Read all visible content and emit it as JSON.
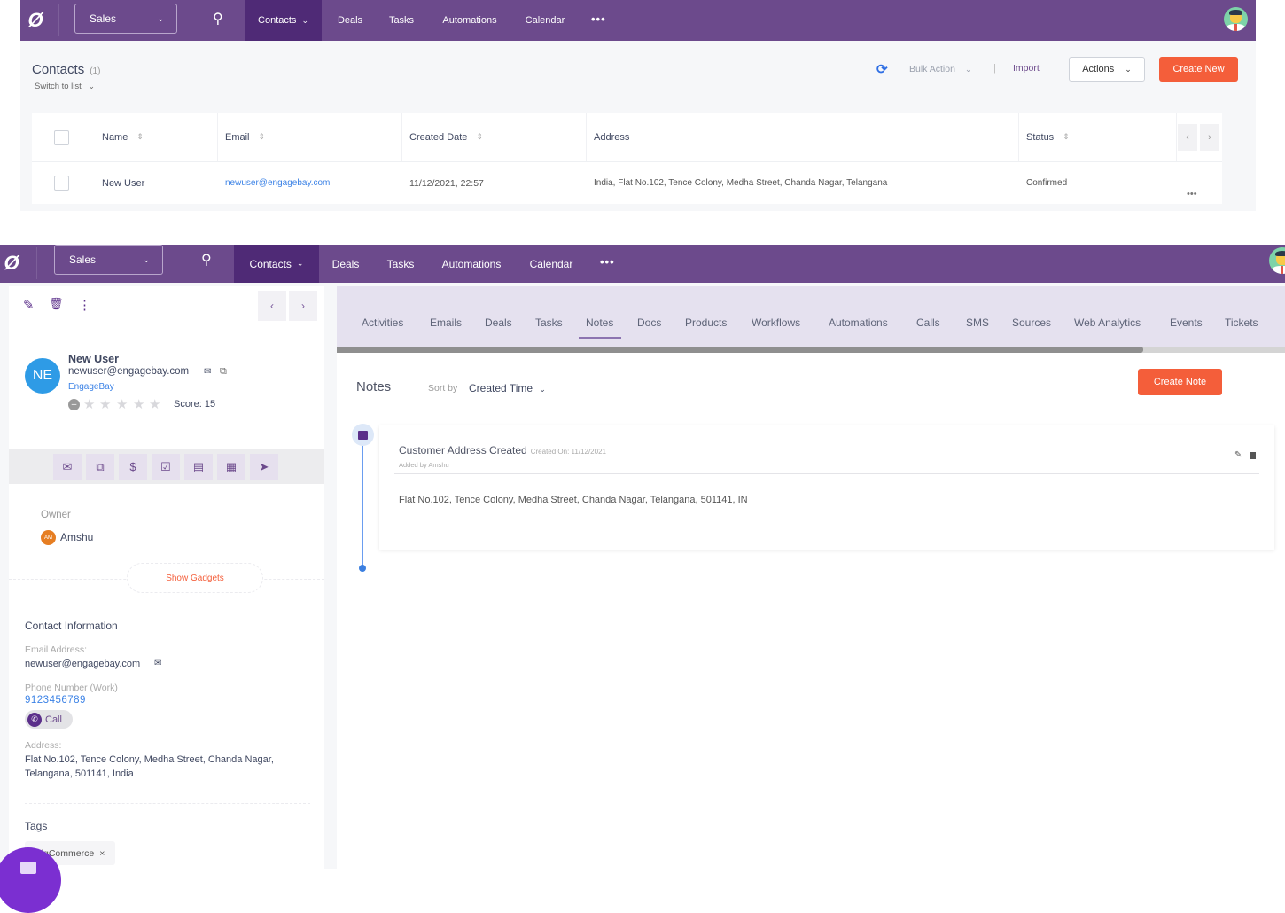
{
  "colors": {
    "brand_purple": "#6c4a8c",
    "nav_active": "#4f2a76",
    "accent_orange": "#f45e3a",
    "link_blue": "#3b82e6",
    "avatar_blue": "#2e9be6",
    "owner_orange": "#e67e22"
  },
  "nav": {
    "logo_glyph": "Ø",
    "module_select": "Sales",
    "search_icon": "search-icon",
    "items": [
      {
        "label": "Contacts",
        "active": true,
        "has_dropdown": true
      },
      {
        "label": "Deals"
      },
      {
        "label": "Tasks"
      },
      {
        "label": "Automations"
      },
      {
        "label": "Calendar"
      }
    ],
    "more": "•••",
    "chevron": "⌄"
  },
  "list_view": {
    "title": "Contacts",
    "count": "(1)",
    "switch_label": "Switch to list",
    "refresh_icon": "⟳",
    "bulk_action": "Bulk Action",
    "separator": "|",
    "import": "Import",
    "actions": "Actions",
    "create_new": "Create New",
    "columns": [
      "Name",
      "Email",
      "Created Date",
      "Address",
      "Status"
    ],
    "sort_glyph": "⇕",
    "pager_prev": "‹",
    "pager_next": "›",
    "rows": [
      {
        "name": "New User",
        "email": "newuser@engagebay.com",
        "created": "11/12/2021, 22:57",
        "address": "India, Flat No.102, Tence Colony, Medha Street, Chanda Nagar, Telangana",
        "status": "Confirmed",
        "more": "•••"
      }
    ]
  },
  "contact": {
    "edit_icon": "✎",
    "delete_icon": "🗑",
    "more_icon": "⋮",
    "prev": "‹",
    "next": "›",
    "initials": "NE",
    "name": "New User",
    "email": "newuser@engagebay.com",
    "email_icon": "✉",
    "copy_icon": "⧉",
    "company": "EngageBay",
    "minus": "–",
    "star_glyph": "★",
    "rating": 0,
    "rating_max": 5,
    "score": "Score: 15",
    "action_icons": [
      "✉",
      "⧉",
      "$",
      "☑",
      "▤",
      "▦",
      "➤"
    ],
    "owner_label": "Owner",
    "owner_initials": "AM",
    "owner_name": "Amshu",
    "show_gadgets": "Show Gadgets",
    "info_title": "Contact Information",
    "email_label": "Email Address:",
    "email_value": "newuser@engagebay.com",
    "phone_label": "Phone Number (Work)",
    "phone_value": "9123456789",
    "call_icon": "✆",
    "call_label": "Call",
    "address_label": "Address:",
    "address_line1": "Flat No.102, Tence Colony, Medha Street, Chanda Nagar,",
    "address_line2": "Telangana, 501141, India",
    "tags_title": "Tags",
    "tag": "BigCommerce",
    "tag_remove": "×"
  },
  "detail": {
    "tabs": [
      "Activities",
      "Emails",
      "Deals",
      "Tasks",
      "Notes",
      "Docs",
      "Products",
      "Workflows",
      "Automations",
      "Calls",
      "SMS",
      "Sources",
      "Web Analytics",
      "Events",
      "Tickets"
    ],
    "active_tab": "Notes",
    "notes_title": "Notes",
    "sort_by_label": "Sort by",
    "sort_by_value": "Created Time",
    "sort_chevron": "⌄",
    "create_note": "Create Note",
    "notes": [
      {
        "title": "Customer Address Created",
        "created_on": "Created On: 11/12/2021",
        "added_by": "Added by Amshu",
        "body": "Flat No.102, Tence Colony, Medha Street, Chanda Nagar, Telangana, 501141, IN",
        "edit_icon": "✎"
      }
    ]
  }
}
